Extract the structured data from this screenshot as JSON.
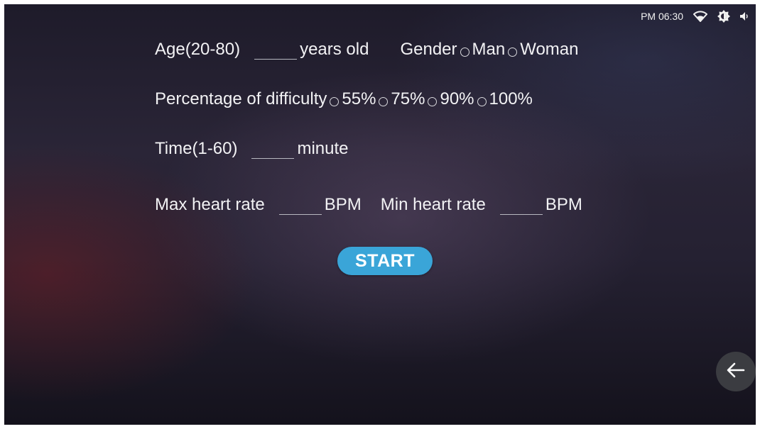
{
  "status_bar": {
    "time": "PM 06:30",
    "icons": [
      "wifi-icon",
      "brightness-icon",
      "volume-icon"
    ]
  },
  "form": {
    "age": {
      "label": "Age(20-80)",
      "value": "",
      "unit": "years old"
    },
    "gender": {
      "label": "Gender",
      "options": [
        "Man",
        "Woman"
      ],
      "selected": null
    },
    "difficulty": {
      "label": "Percentage of difficulty",
      "options": [
        "55%",
        "75%",
        "90%",
        "100%"
      ],
      "selected": null
    },
    "time": {
      "label": "Time(1-60)",
      "value": "",
      "unit": "minute"
    },
    "max_heart_rate": {
      "label": "Max heart rate",
      "value": "",
      "unit": "BPM"
    },
    "min_heart_rate": {
      "label": "Min heart rate",
      "value": "",
      "unit": "BPM"
    }
  },
  "start_button": {
    "label": "START",
    "color": "#3aa5d8"
  },
  "back_button": {
    "icon": "arrow-left-icon"
  }
}
